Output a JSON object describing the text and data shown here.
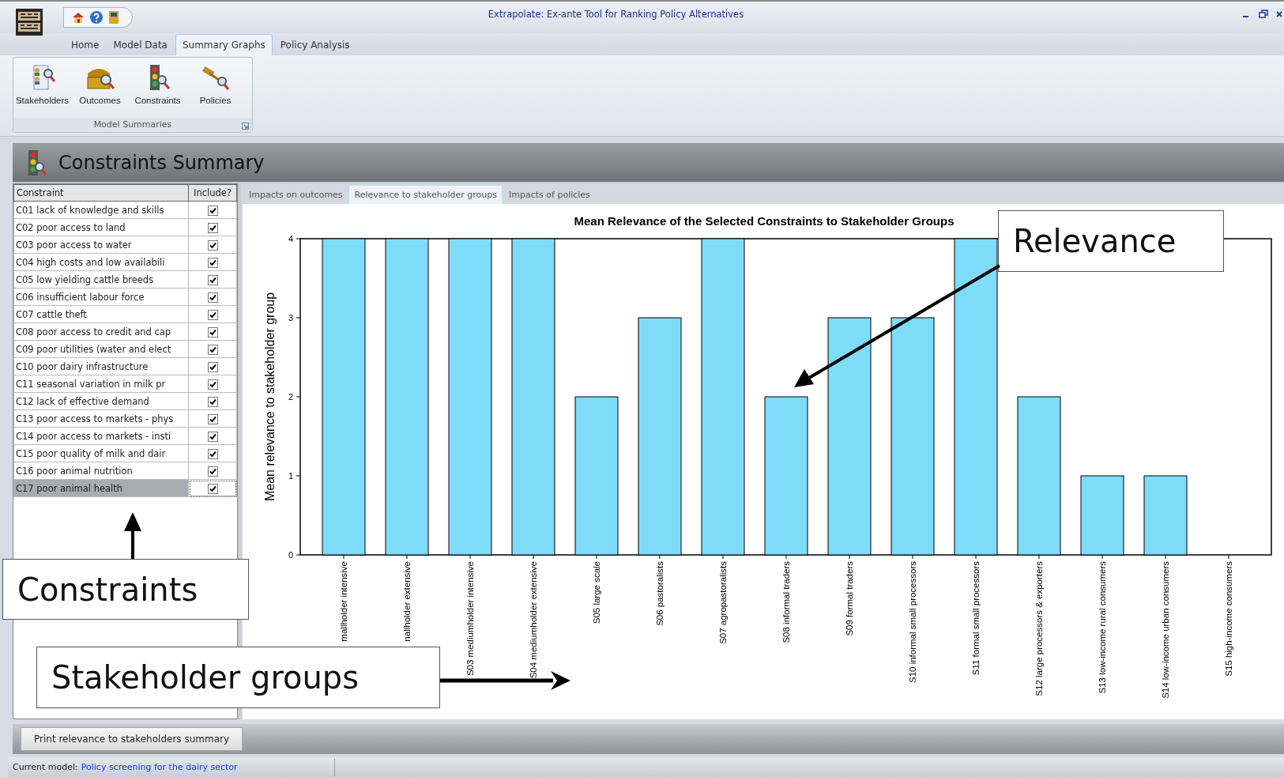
{
  "window": {
    "title": "Extrapolate: Ex-ante Tool for Ranking Policy Alternatives"
  },
  "ribbon_tabs": [
    {
      "label": "Home",
      "selected": false
    },
    {
      "label": "Model Data",
      "selected": false
    },
    {
      "label": "Summary Graphs",
      "selected": true
    },
    {
      "label": "Policy Analysis",
      "selected": false
    }
  ],
  "ribbon": {
    "group_label": "Model Summaries",
    "buttons": [
      {
        "label": "Stakeholders",
        "kind": "people"
      },
      {
        "label": "Outcomes",
        "kind": "chest"
      },
      {
        "label": "Constraints",
        "kind": "traffic"
      },
      {
        "label": "Policies",
        "kind": "gavel"
      }
    ]
  },
  "section_title": "Constraints Summary",
  "table": {
    "columns": [
      "Constraint",
      "Include?"
    ],
    "rows": [
      {
        "label": "C01 lack of knowledge and skills",
        "checked": true,
        "selected": false
      },
      {
        "label": "C02 poor access to land",
        "checked": true,
        "selected": false
      },
      {
        "label": "C03 poor access to water",
        "checked": true,
        "selected": false
      },
      {
        "label": "C04 high costs and low availabili",
        "checked": true,
        "selected": false
      },
      {
        "label": "C05 low yielding cattle breeds",
        "checked": true,
        "selected": false
      },
      {
        "label": "C06 insufficient labour force",
        "checked": true,
        "selected": false
      },
      {
        "label": "C07 cattle theft",
        "checked": true,
        "selected": false
      },
      {
        "label": "C08 poor access to credit and cap",
        "checked": true,
        "selected": false
      },
      {
        "label": "C09 poor utilities (water and elect",
        "checked": true,
        "selected": false
      },
      {
        "label": "C10 poor dairy infrastructure",
        "checked": true,
        "selected": false
      },
      {
        "label": "C11 seasonal variation in milk pr",
        "checked": true,
        "selected": false
      },
      {
        "label": "C12 lack of effective demand",
        "checked": true,
        "selected": false
      },
      {
        "label": "C13 poor access to markets - phys",
        "checked": true,
        "selected": false
      },
      {
        "label": "C14 poor access to markets - insti",
        "checked": true,
        "selected": false
      },
      {
        "label": "C15 poor quality of milk and dair",
        "checked": true,
        "selected": false
      },
      {
        "label": "C16 poor animal nutrition",
        "checked": true,
        "selected": false
      },
      {
        "label": "C17 poor animal health",
        "checked": true,
        "selected": true
      }
    ]
  },
  "chart_tabs": [
    {
      "label": "Impacts on outcomes",
      "selected": false
    },
    {
      "label": "Relevance to stakeholder groups",
      "selected": true
    },
    {
      "label": "Impacts of policies",
      "selected": false
    }
  ],
  "chart_data": {
    "type": "bar",
    "title": "Mean Relevance of the Selected Constraints to Stakeholder Groups",
    "ylabel": "Mean relevance to stakeholder group",
    "categories": [
      "mallholder intensive",
      "nallholder extensive",
      "S03 mediumholder intensive",
      "S04 mediumholder extensive",
      "S05 large scale",
      "S06 pastoralists",
      "S07 agropastoralists",
      "S08 informal traders",
      "S09 formal traders",
      "S10 informal small processors",
      "S11  formal small processors",
      "S12 large processors & exporters",
      "S13 low-income rural consumers",
      "S14 low-income urban consumers",
      "S15 high-income consumers"
    ],
    "series": [
      {
        "color": "#7fdcf8",
        "values": [
          4,
          4,
          4,
          4,
          2,
          3,
          4,
          2,
          3,
          3,
          4,
          2,
          1,
          1,
          0
        ]
      }
    ],
    "ylim": [
      0,
      4
    ],
    "yticks": [
      0,
      1,
      2,
      3,
      4
    ]
  },
  "print_button": "Print relevance to stakeholders summary",
  "status_bar": {
    "label": "Current model:",
    "value": "Policy screening for the dairy sector"
  },
  "annotations": [
    {
      "text": "Relevance"
    },
    {
      "text": "Constraints"
    },
    {
      "text": "Stakeholder groups"
    }
  ]
}
